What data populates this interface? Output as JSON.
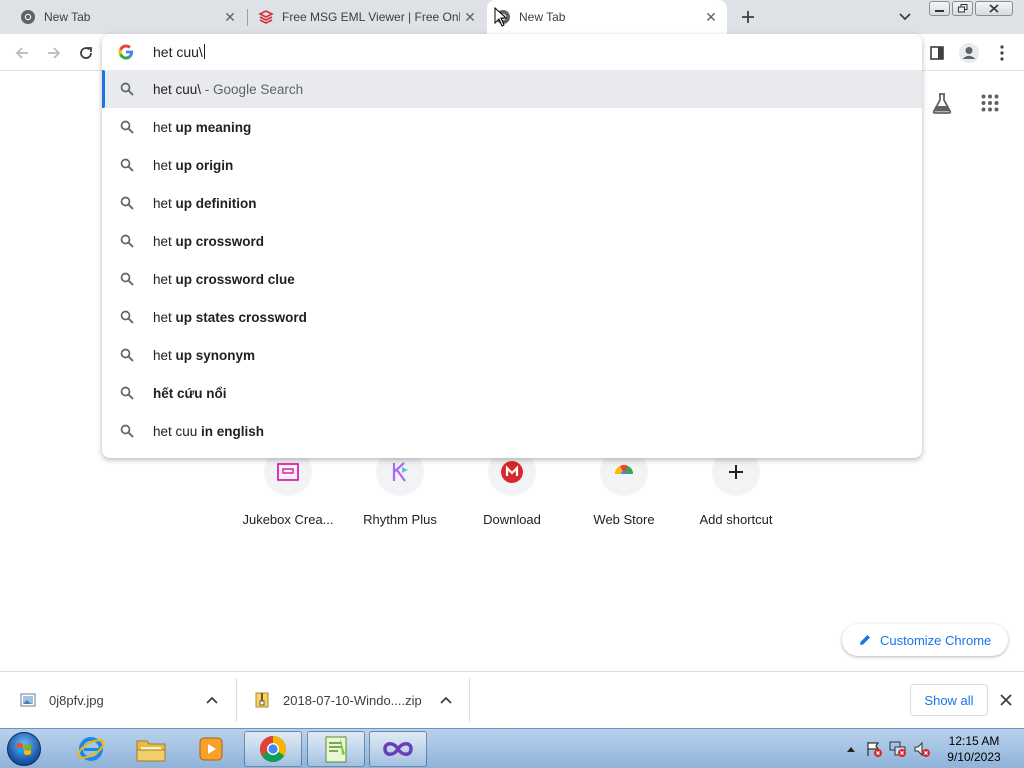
{
  "tabs": [
    {
      "title": "New Tab",
      "icon": "chrome-icon",
      "active": false
    },
    {
      "title": "Free MSG EML Viewer | Free Onli",
      "icon": "stack-logo-icon",
      "active": false
    },
    {
      "title": "New Tab",
      "icon": "chrome-icon",
      "active": true
    }
  ],
  "omnibox": {
    "input_text": "het cuu\\",
    "suggestions": [
      {
        "plain": "het cuu\\",
        "bold": "",
        "suffix": " - Google Search"
      },
      {
        "plain": "het ",
        "bold": "up meaning",
        "suffix": ""
      },
      {
        "plain": "het ",
        "bold": "up origin",
        "suffix": ""
      },
      {
        "plain": "het ",
        "bold": "up definition",
        "suffix": ""
      },
      {
        "plain": "het ",
        "bold": "up crossword",
        "suffix": ""
      },
      {
        "plain": "het ",
        "bold": "up crossword clue",
        "suffix": ""
      },
      {
        "plain": "het ",
        "bold": "up states crossword",
        "suffix": ""
      },
      {
        "plain": "het ",
        "bold": "up synonym",
        "suffix": ""
      },
      {
        "plain": "",
        "bold": "hết cứu nổi",
        "suffix": ""
      },
      {
        "plain": "het cuu ",
        "bold": "in english",
        "suffix": ""
      }
    ]
  },
  "shortcuts": [
    {
      "label": "Jukebox Crea...",
      "icon": "jukebox-icon"
    },
    {
      "label": "Rhythm Plus",
      "icon": "rhythm-plus-icon"
    },
    {
      "label": "Download",
      "icon": "mega-icon"
    },
    {
      "label": "Web Store",
      "icon": "web-store-icon"
    },
    {
      "label": "Add shortcut",
      "icon": "plus-icon"
    }
  ],
  "customize_label": "Customize Chrome",
  "downloads": [
    {
      "name": "0j8pfv.jpg",
      "icon": "image-file-icon"
    },
    {
      "name": "2018-07-10-Windo....zip",
      "icon": "zip-file-icon"
    }
  ],
  "show_all_label": "Show all",
  "clock": {
    "time": "12:15 AM",
    "date": "9/10/2023"
  },
  "colors": {
    "accent": "#1a73e8",
    "tab_strip": "#dee1e6",
    "selected_row": "#e8eaed"
  }
}
